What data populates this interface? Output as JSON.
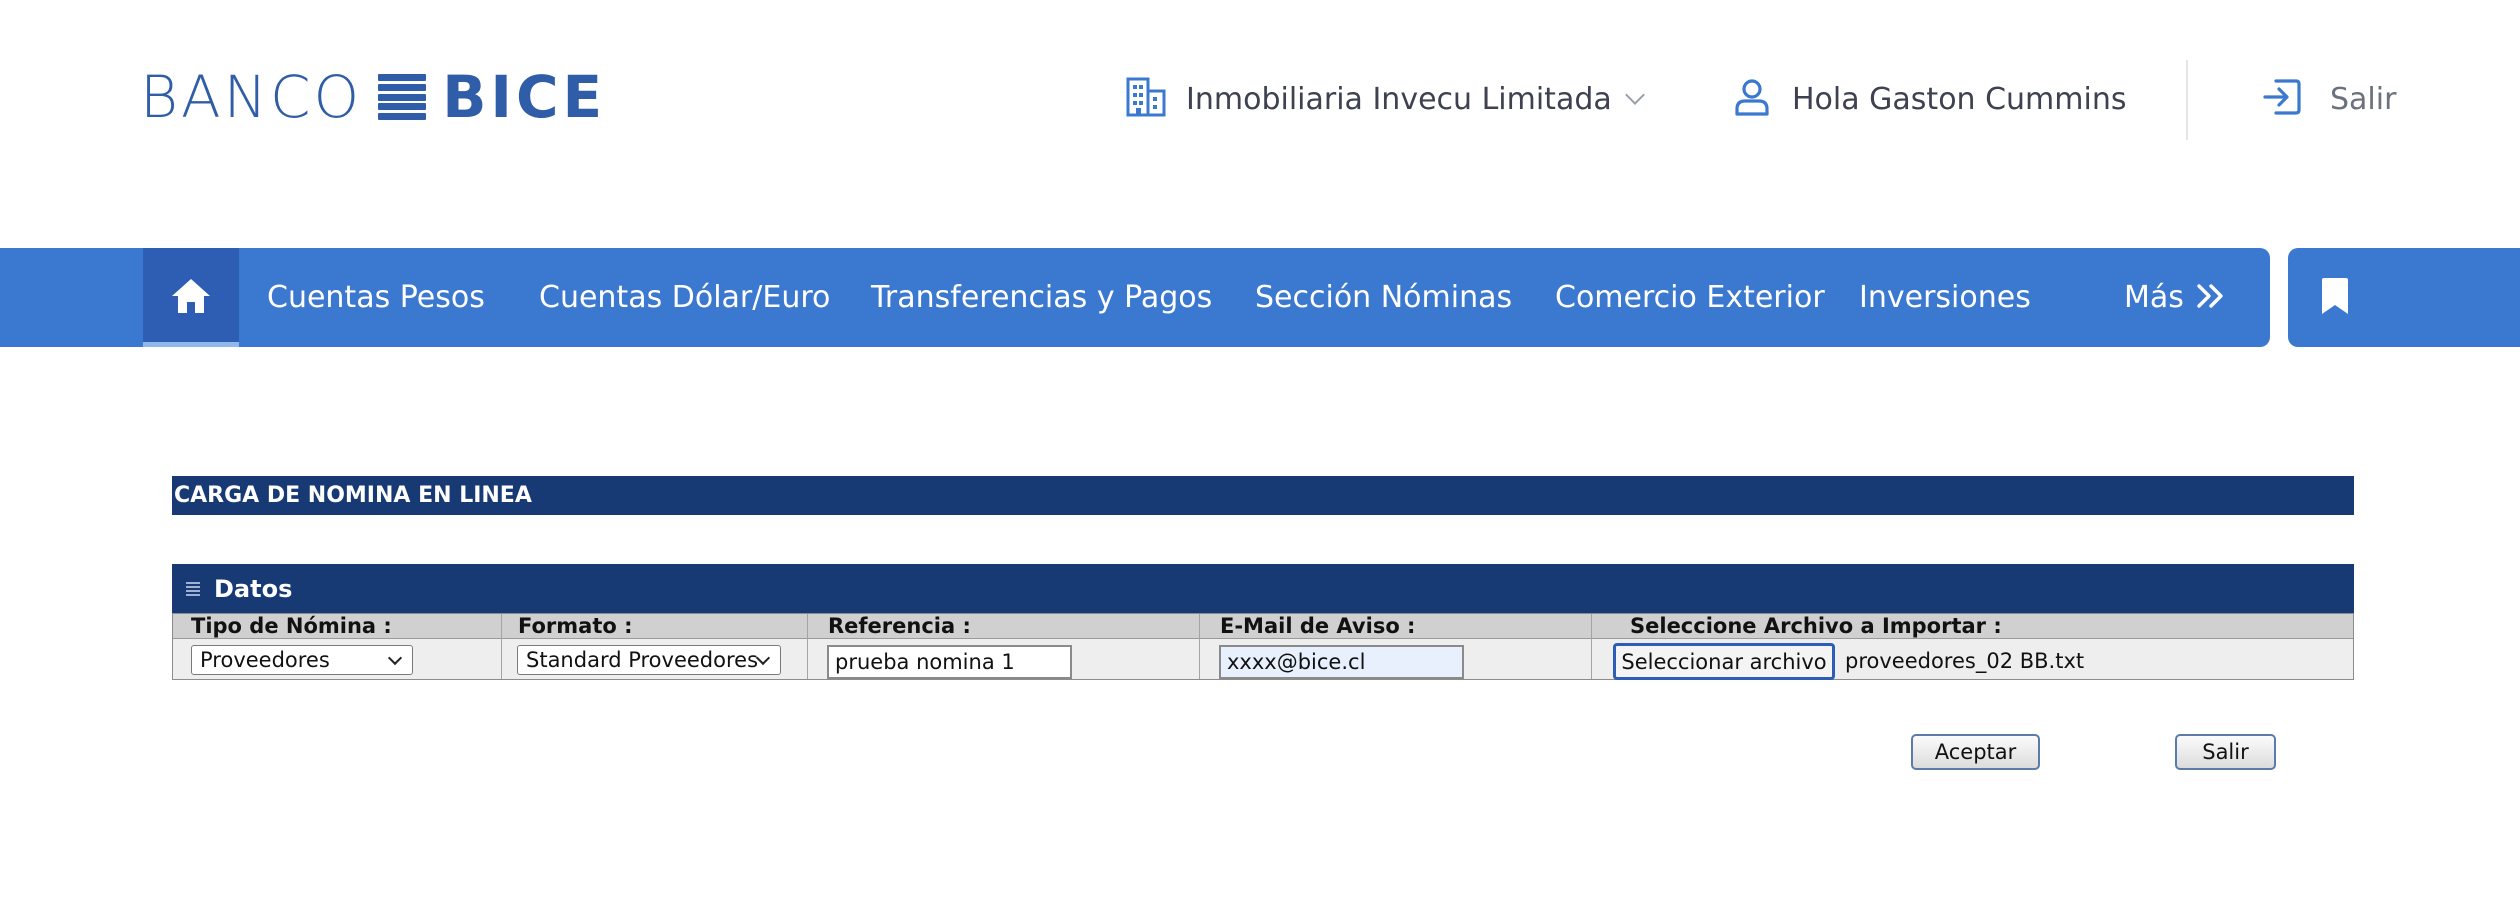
{
  "header": {
    "logo_banco": "BANCO",
    "logo_bice": "BICE",
    "company_name": "Inmobiliaria Invecu Limitada",
    "greeting": "Hola Gaston Cummins",
    "logout_label": "Salir",
    "icons": {
      "company": "building-icon",
      "company_dropdown": "chevron-down-icon",
      "user": "user-icon",
      "logout": "logout-icon"
    }
  },
  "nav": {
    "home_icon": "home-icon",
    "items": [
      {
        "label": "Cuentas Pesos"
      },
      {
        "label": "Cuentas Dólar/Euro"
      },
      {
        "label": "Transferencias y Pagos"
      },
      {
        "label": "Sección Nóminas"
      },
      {
        "label": "Comercio Exterior"
      },
      {
        "label": "Inversiones"
      }
    ],
    "more_label": "Más",
    "more_icon": "double-chevron-right-icon",
    "bookmark_icon": "bookmark-icon"
  },
  "form": {
    "title": "CARGA DE NOMINA EN LINEA",
    "section_title": "Datos",
    "section_icon": "menu-lines-icon",
    "headers": {
      "tipo": "Tipo de Nómina :",
      "formato": "Formato :",
      "referencia": "Referencia :",
      "email": "E-Mail de Aviso :",
      "archivo": "Seleccione Archivo a Importar :"
    },
    "tipo_value": "Proveedores",
    "formato_value": "Standard Proveedores",
    "referencia_value": "prueba nomina 1",
    "email_value": "xxxx@bice.cl",
    "file_button_label": "Seleccionar archivo",
    "file_name": "proveedores_02 BB.txt",
    "accept_label": "Aceptar",
    "exit_label": "Salir"
  },
  "colors": {
    "brand_blue": "#2f5da8",
    "nav_blue": "#3b78cf",
    "nav_active": "#2d5eb3",
    "form_header_navy": "#173a74"
  }
}
